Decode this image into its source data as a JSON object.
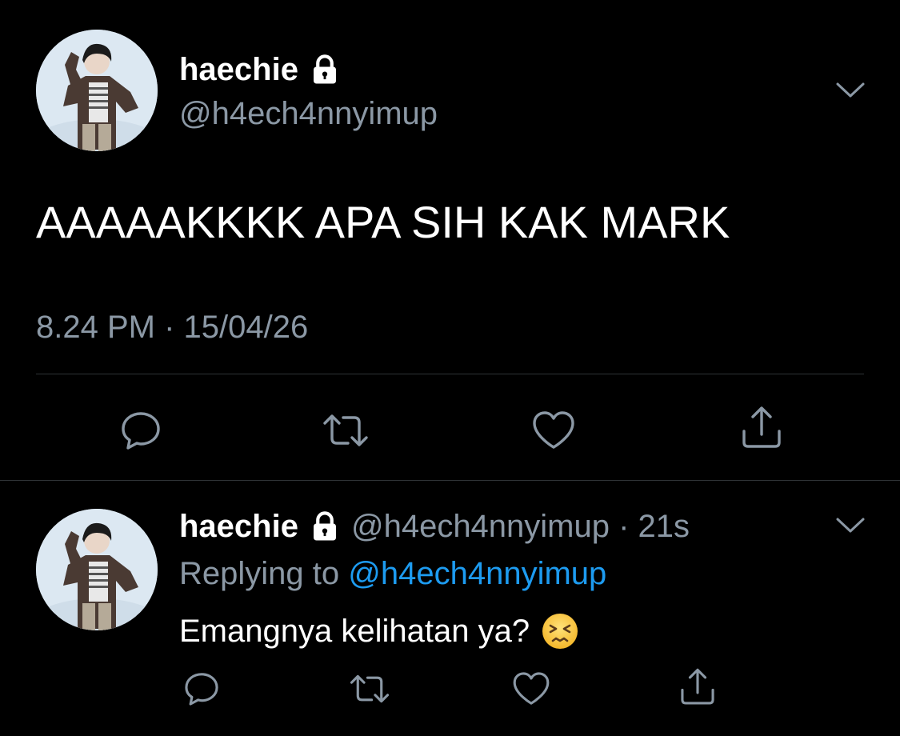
{
  "main_tweet": {
    "display_name": "haechie",
    "handle": "@h4ech4nnyimup",
    "text": "AAAAAKKKK APA SIH KAK MARK",
    "timestamp": "8.24 PM · 15/04/26",
    "protected_icon": "lock-icon",
    "menu_icon": "chevron-down-icon",
    "actions": [
      "reply-icon",
      "retweet-icon",
      "like-icon",
      "share-icon"
    ]
  },
  "reply_tweet": {
    "display_name": "haechie",
    "meta": "@h4ech4nnyimup · 21s",
    "replying_prefix": "Replying to",
    "replying_handle": "@h4ech4nnyimup",
    "text": "Emangnya kelihatan ya?",
    "emoji": "persevering-face-emoji",
    "protected_icon": "lock-icon",
    "menu_icon": "chevron-down-icon",
    "actions": [
      "reply-icon",
      "retweet-icon",
      "like-icon",
      "share-icon"
    ]
  },
  "colors": {
    "background": "#000000",
    "primary_text": "#ffffff",
    "secondary_text": "#8b98a5",
    "link": "#1d9bf0",
    "divider": "#2f3336",
    "icon": "#8b98a5"
  }
}
